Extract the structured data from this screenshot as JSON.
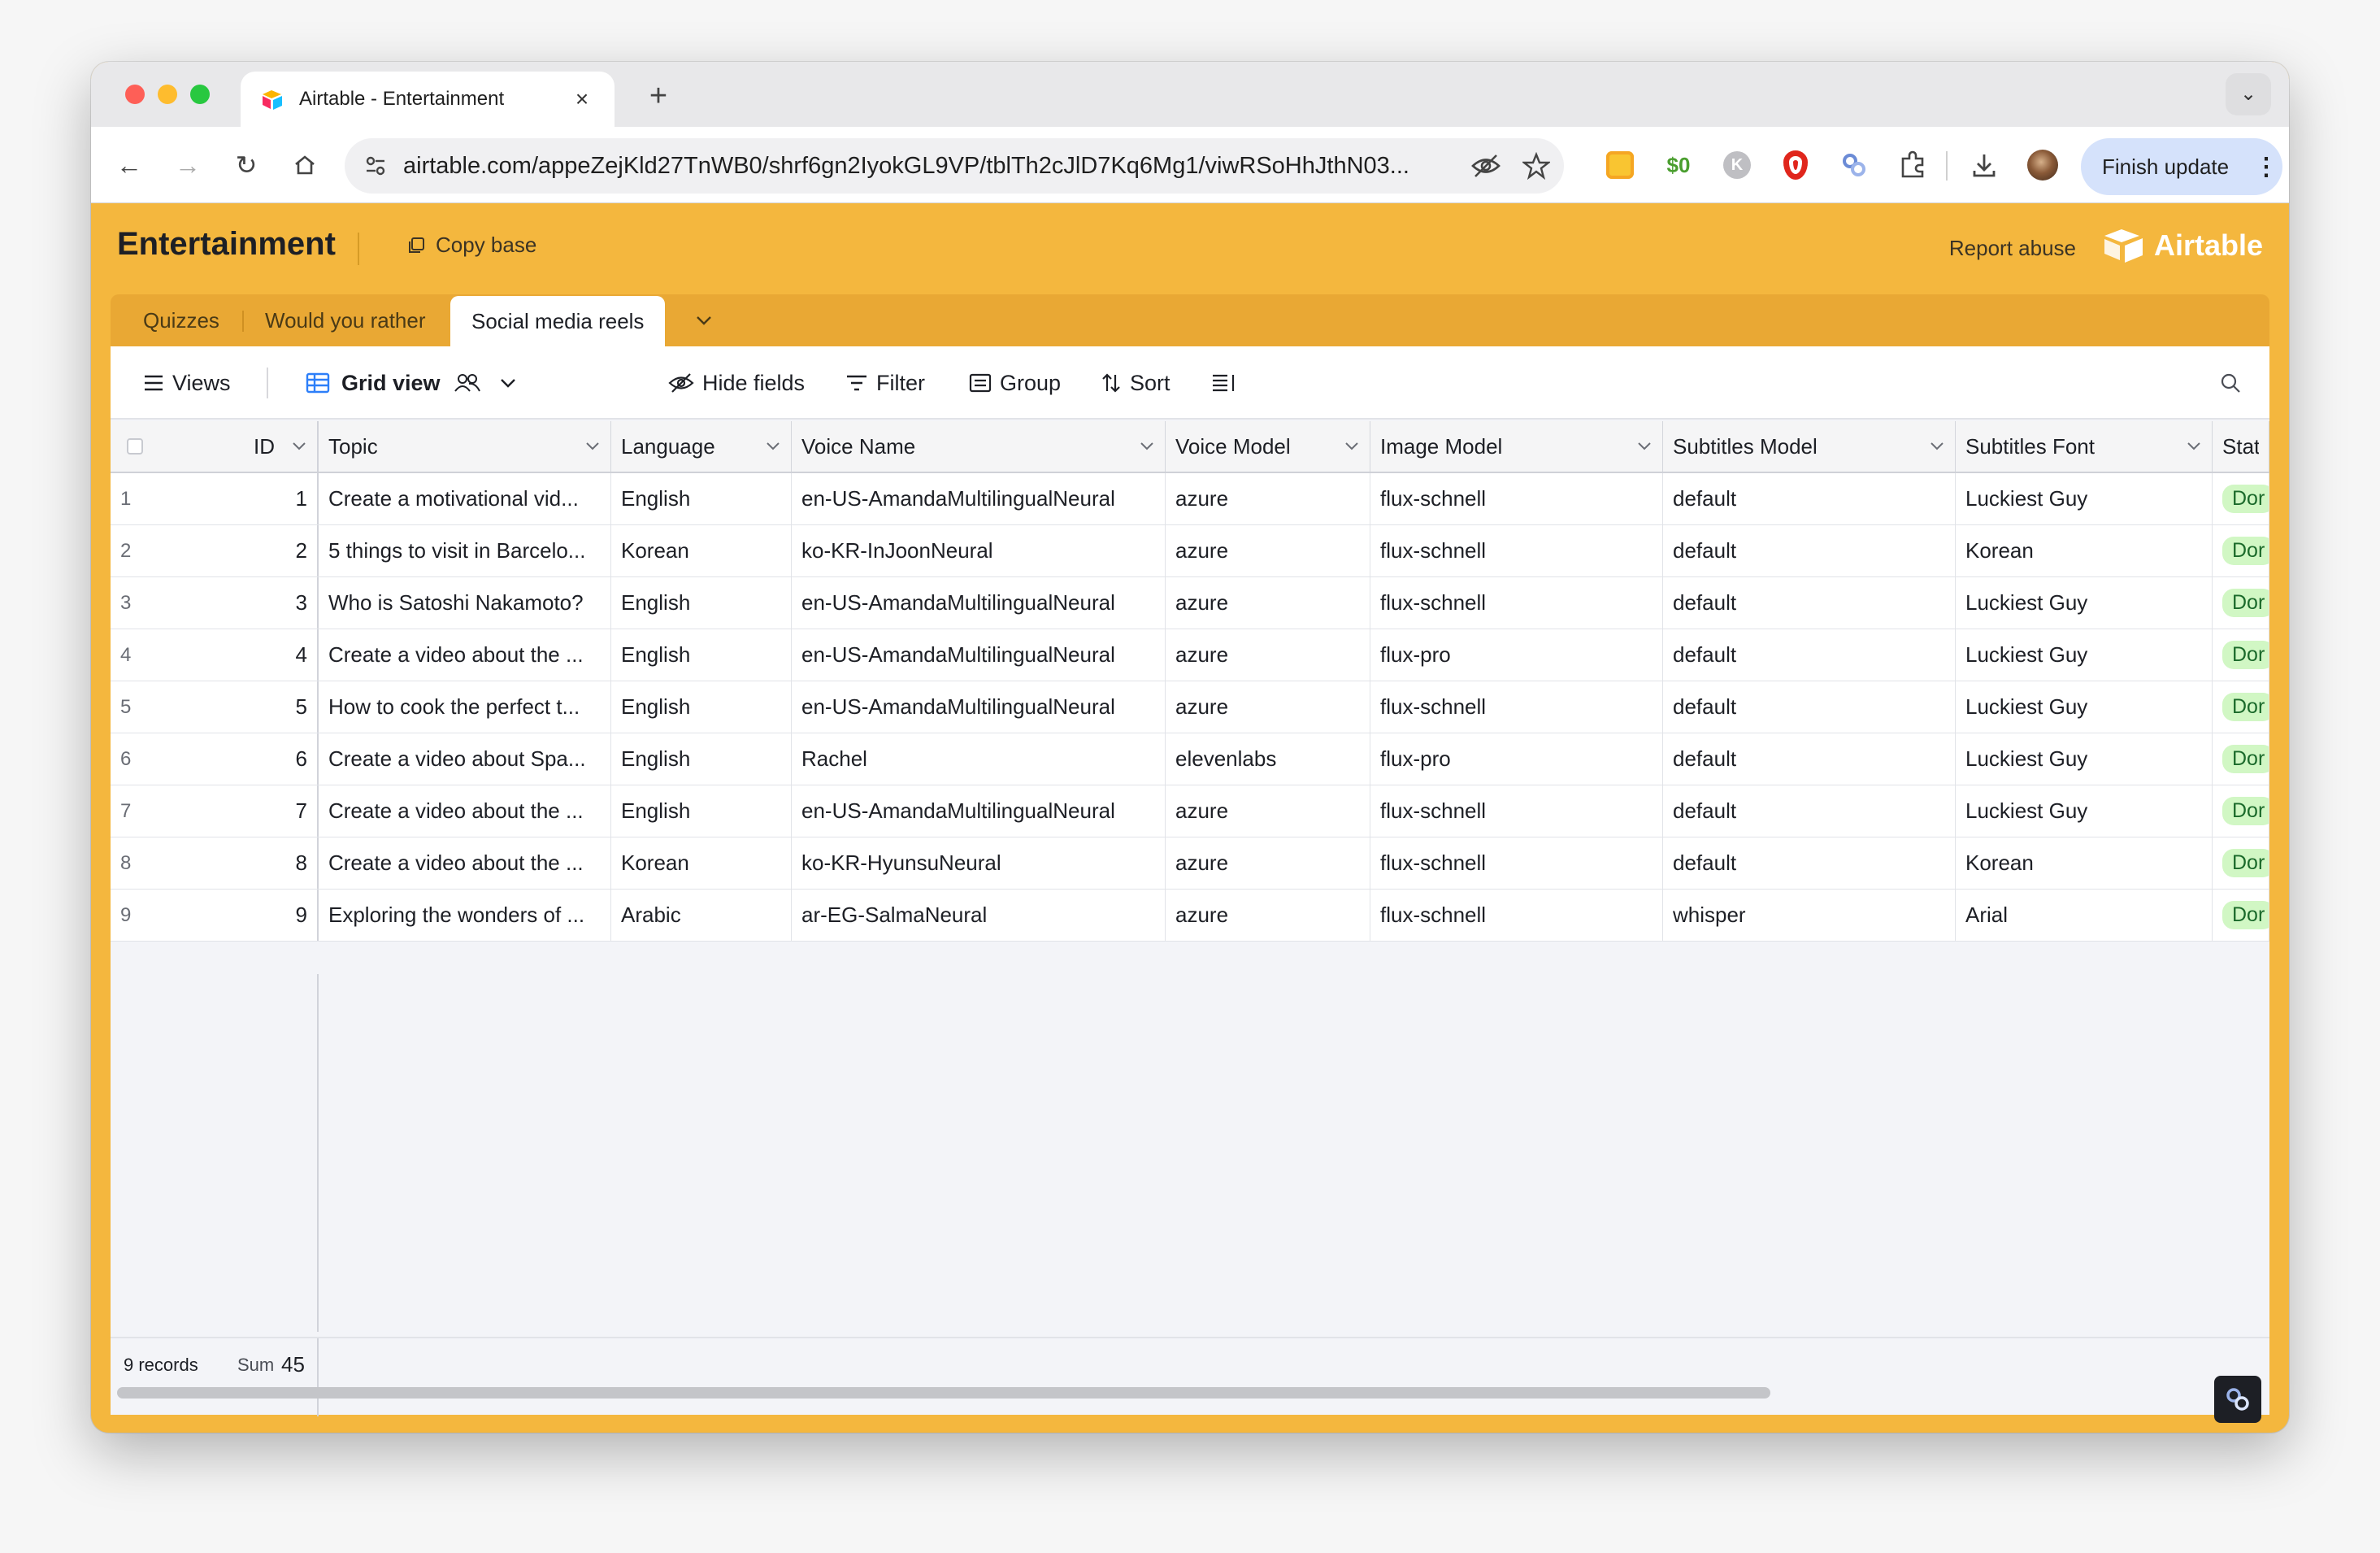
{
  "browser": {
    "tab_title": "Airtable - Entertainment",
    "new_tab": "+",
    "url": "airtable.com/appeZejKld27TnWB0/shrf6gn2IyokGL9VP/tblTh2cJlD7Kq6Mg1/viwRSoHhJthN03...",
    "finish_update": "Finish update"
  },
  "header": {
    "base_name": "Entertainment",
    "copy_base": "Copy base",
    "report_abuse": "Report abuse",
    "logo_text": "Airtable"
  },
  "tables": [
    {
      "label": "Quizzes"
    },
    {
      "label": "Would you rather"
    },
    {
      "label": "Social media reels",
      "active": true
    }
  ],
  "viewbar": {
    "views": "Views",
    "grid_view": "Grid view",
    "hide_fields": "Hide fields",
    "filter": "Filter",
    "group": "Group",
    "sort": "Sort"
  },
  "columns": [
    "ID",
    "Topic",
    "Language",
    "Voice Name",
    "Voice Model",
    "Image Model",
    "Subtitles Model",
    "Subtitles Font",
    "Statu"
  ],
  "rows": [
    {
      "n": "1",
      "id": "1",
      "topic": "Create a motivational vid...",
      "language": "English",
      "voice_name": "en-US-AmandaMultilingualNeural",
      "voice_model": "azure",
      "image_model": "flux-schnell",
      "subtitles_model": "default",
      "subtitles_font": "Luckiest Guy",
      "status": "Dor"
    },
    {
      "n": "2",
      "id": "2",
      "topic": "5 things to visit in Barcelo...",
      "language": "Korean",
      "voice_name": "ko-KR-InJoonNeural",
      "voice_model": "azure",
      "image_model": "flux-schnell",
      "subtitles_model": "default",
      "subtitles_font": "Korean",
      "status": "Dor"
    },
    {
      "n": "3",
      "id": "3",
      "topic": "Who is Satoshi Nakamoto?",
      "language": "English",
      "voice_name": "en-US-AmandaMultilingualNeural",
      "voice_model": "azure",
      "image_model": "flux-schnell",
      "subtitles_model": "default",
      "subtitles_font": "Luckiest Guy",
      "status": "Dor"
    },
    {
      "n": "4",
      "id": "4",
      "topic": "Create a video about the ...",
      "language": "English",
      "voice_name": "en-US-AmandaMultilingualNeural",
      "voice_model": "azure",
      "image_model": "flux-pro",
      "subtitles_model": "default",
      "subtitles_font": "Luckiest Guy",
      "status": "Dor"
    },
    {
      "n": "5",
      "id": "5",
      "topic": "How to cook the perfect t...",
      "language": "English",
      "voice_name": "en-US-AmandaMultilingualNeural",
      "voice_model": "azure",
      "image_model": "flux-schnell",
      "subtitles_model": "default",
      "subtitles_font": "Luckiest Guy",
      "status": "Dor"
    },
    {
      "n": "6",
      "id": "6",
      "topic": "Create a video about Spa...",
      "language": "English",
      "voice_name": "Rachel",
      "voice_model": "elevenlabs",
      "image_model": "flux-pro",
      "subtitles_model": "default",
      "subtitles_font": "Luckiest Guy",
      "status": "Dor"
    },
    {
      "n": "7",
      "id": "7",
      "topic": "Create a video about the ...",
      "language": "English",
      "voice_name": "en-US-AmandaMultilingualNeural",
      "voice_model": "azure",
      "image_model": "flux-schnell",
      "subtitles_model": "default",
      "subtitles_font": "Luckiest Guy",
      "status": "Dor"
    },
    {
      "n": "8",
      "id": "8",
      "topic": "Create a video about the ...",
      "language": "Korean",
      "voice_name": "ko-KR-HyunsuNeural",
      "voice_model": "azure",
      "image_model": "flux-schnell",
      "subtitles_model": "default",
      "subtitles_font": "Korean",
      "status": "Dor"
    },
    {
      "n": "9",
      "id": "9",
      "topic": "Exploring the wonders of ...",
      "language": "Arabic",
      "voice_name": "ar-EG-SalmaNeural",
      "voice_model": "azure",
      "image_model": "flux-schnell",
      "subtitles_model": "whisper",
      "subtitles_font": "Arial",
      "status": "Dor"
    }
  ],
  "footer": {
    "records": "9 records",
    "sum_label": "Sum",
    "sum_value": "45"
  },
  "colors": {
    "base_color": "#f4b73e",
    "tablebar": "#e9a834",
    "status_pill": "#d1f7c4"
  },
  "icons": [
    "airtable-favicon",
    "back-icon",
    "forward-icon",
    "reload-icon",
    "home-icon",
    "site-settings-icon",
    "eye-off-icon",
    "star-icon",
    "extension-icon",
    "puzzle-icon",
    "download-icon",
    "avatar",
    "grid-icon",
    "people-icon",
    "chevron-down-icon",
    "filter-icon",
    "group-icon",
    "sort-icon",
    "row-height-icon",
    "search-icon",
    "help-icon"
  ]
}
